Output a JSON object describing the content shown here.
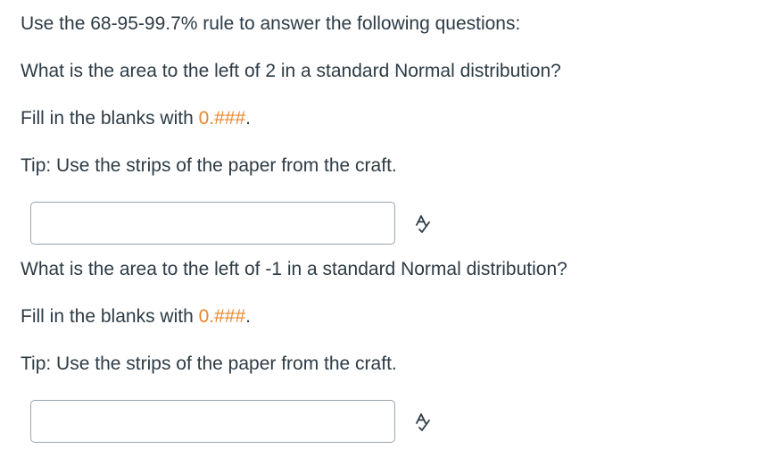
{
  "intro": "Use the 68-95-99.7% rule to answer the following questions:",
  "questions": [
    {
      "prompt": "What is the area to the left of 2 in a standard Normal distribution?",
      "fill_prefix": "Fill in the blanks with ",
      "fill_format": "0.###",
      "fill_suffix": ".",
      "tip": "Tip: Use the strips of the paper from the craft.",
      "answer_value": "",
      "icon": "spell-check-icon"
    },
    {
      "prompt": "What is the area to the left of -1 in a standard Normal distribution?",
      "fill_prefix": "Fill in the blanks with ",
      "fill_format": "0.###",
      "fill_suffix": ".",
      "tip": "Tip: Use the strips of the paper from the craft.",
      "answer_value": "",
      "icon": "spell-check-icon"
    }
  ],
  "colors": {
    "text": "#2d3b45",
    "accent": "#e8862a",
    "input_border": "#9aa5ad"
  }
}
